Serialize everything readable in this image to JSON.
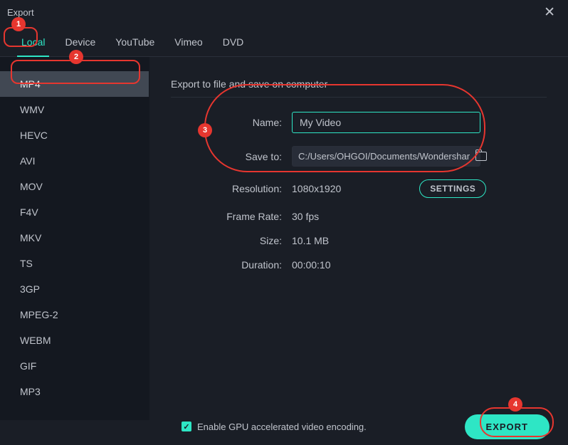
{
  "window": {
    "title": "Export"
  },
  "tabs": {
    "items": [
      {
        "label": "Local"
      },
      {
        "label": "Device"
      },
      {
        "label": "YouTube"
      },
      {
        "label": "Vimeo"
      },
      {
        "label": "DVD"
      }
    ]
  },
  "sidebar": {
    "formats": [
      {
        "label": "MP4"
      },
      {
        "label": "WMV"
      },
      {
        "label": "HEVC"
      },
      {
        "label": "AVI"
      },
      {
        "label": "MOV"
      },
      {
        "label": "F4V"
      },
      {
        "label": "MKV"
      },
      {
        "label": "TS"
      },
      {
        "label": "3GP"
      },
      {
        "label": "MPEG-2"
      },
      {
        "label": "WEBM"
      },
      {
        "label": "GIF"
      },
      {
        "label": "MP3"
      }
    ]
  },
  "main": {
    "description": "Export to file and save on computer",
    "name_label": "Name:",
    "name_value": "My Video",
    "saveto_label": "Save to:",
    "saveto_value": "C:/Users/OHGOI/Documents/Wondershar",
    "resolution_label": "Resolution:",
    "resolution_value": "1080x1920",
    "settings_label": "SETTINGS",
    "framerate_label": "Frame Rate:",
    "framerate_value": "30 fps",
    "size_label": "Size:",
    "size_value": "10.1 MB",
    "duration_label": "Duration:",
    "duration_value": "00:00:10"
  },
  "footer": {
    "gpu_label": "Enable GPU accelerated video encoding.",
    "export_label": "EXPORT"
  },
  "annotations": {
    "1": "1",
    "2": "2",
    "3": "3",
    "4": "4"
  }
}
